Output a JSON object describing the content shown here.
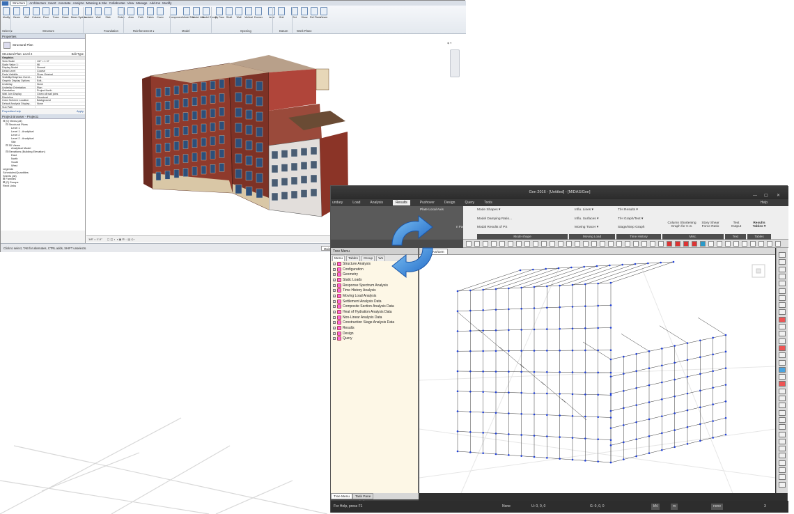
{
  "revit": {
    "tabs": [
      "Structure",
      "Architecture",
      "Insert",
      "Annotate",
      "Analyze",
      "Massing & Site",
      "Collaborate",
      "View",
      "Manage",
      "Add-Ins",
      "Modify"
    ],
    "active_tab": "Structure",
    "tools": [
      "Modify",
      "Beam",
      "Wall",
      "Column",
      "Floor",
      "Truss",
      "Brace",
      "Beam System",
      "Isolated",
      "Wall",
      "Slab",
      "Rebar",
      "Area",
      "Path",
      "Fabric",
      "Cover",
      "Component",
      "Model Text",
      "Model Line",
      "Model Group",
      "By Face",
      "Shaft",
      "Wall",
      "Vertical",
      "Dormer",
      "Level",
      "Grid",
      "Set",
      "Show",
      "Ref Plane",
      "Viewer"
    ],
    "panel_labels": [
      "Select ▾",
      "Structure",
      "Foundation",
      "Reinforcement ▾",
      "Model",
      "Opening",
      "Datum",
      "Work Plane"
    ],
    "properties": {
      "header": "Properties",
      "type_name": "Structural Plan",
      "selector": "Structural Plan: Level 2",
      "edit_type": "Edit Type",
      "group_graphics": "Graphics",
      "rows": [
        {
          "k": "View Scale",
          "v": "1/8\" = 1'-0\""
        },
        {
          "k": "Scale Value  1:",
          "v": "96"
        },
        {
          "k": "Display Model",
          "v": "Normal"
        },
        {
          "k": "Detail Level",
          "v": "Coarse"
        },
        {
          "k": "Parts Visibility",
          "v": "Show Original"
        },
        {
          "k": "Visibility/Graphics Overri...",
          "v": "Edit..."
        },
        {
          "k": "Graphic Display Options",
          "v": "Edit..."
        },
        {
          "k": "Underlay",
          "v": "None"
        },
        {
          "k": "Underlay Orientation",
          "v": "Plan"
        },
        {
          "k": "Orientation",
          "v": "Project North"
        },
        {
          "k": "Wall Join Display",
          "v": "Clean all wall joins"
        },
        {
          "k": "Discipline",
          "v": "Structural"
        },
        {
          "k": "Color Scheme Location",
          "v": "Background"
        },
        {
          "k": "Default Analysis Display...",
          "v": "None"
        },
        {
          "k": "Sun Path",
          "v": ""
        }
      ],
      "help_link": "Properties help",
      "apply": "Apply"
    },
    "browser": {
      "header": "Project Browser - Project1",
      "items": [
        {
          "t": "⊟ [0] Views (all)",
          "i": 0
        },
        {
          "t": "⊟ Structural Plans",
          "i": 1
        },
        {
          "t": "Level 1",
          "i": 3
        },
        {
          "t": "Level 1 - Analytical",
          "i": 3
        },
        {
          "t": "Level 2",
          "i": 3
        },
        {
          "t": "Level 2 - Analytical",
          "i": 3
        },
        {
          "t": "Site",
          "i": 3
        },
        {
          "t": "⊟ 3D Views",
          "i": 1
        },
        {
          "t": "Analytical Model",
          "i": 3
        },
        {
          "t": "⊟ Elevations (Building Elevation)",
          "i": 1
        },
        {
          "t": "East",
          "i": 3
        },
        {
          "t": "North",
          "i": 3
        },
        {
          "t": "South",
          "i": 3
        },
        {
          "t": "West",
          "i": 3
        },
        {
          "t": "Legends",
          "i": 0
        },
        {
          "t": "Schedules/Quantities",
          "i": 0
        },
        {
          "t": "Sheets (all)",
          "i": 0
        },
        {
          "t": "⊞ Families",
          "i": 0
        },
        {
          "t": "⊞ [0] Groups",
          "i": 0
        },
        {
          "t": "Revit Links",
          "i": 0
        }
      ]
    },
    "view_control": "1/8\" = 1'-0\"",
    "status": "Click to select, TAB for alternates, CTRL adds, SHIFT unselects.",
    "status_right": "Main Model"
  },
  "midas": {
    "title": "Gen 2016 - [Untitled] - [MIDAS/Gen]",
    "help": "Help",
    "tabs": [
      "undary",
      "Load",
      "Analysis",
      "Results",
      "Pushover",
      "Design",
      "Query",
      "Tools"
    ],
    "active_tab": "Results",
    "ribbon": {
      "items": [
        "Mode Shapes ▾",
        "Model Damping Ratio...",
        "Modal Results of PS",
        "Influ. Lines ▾",
        "Influ. Surfaces ▾",
        "Moving Tracer ▾",
        "T/H Results ▾",
        "T/H Graph/Text ▾",
        "Stage/Step Graph",
        "Column Shortening Graph for C.S.",
        "Story Shear Force Ratio",
        "Text Output",
        "Results Tables ▾"
      ],
      "groups": [
        "Mode shape",
        "Moving Load",
        "Time History",
        "Misc.",
        "Text",
        "Tables"
      ],
      "left_item": "Plate Local Axis",
      "left_item2": "n Factor"
    },
    "tree_menu": {
      "title": "Tree Menu",
      "tabs": [
        "Menu",
        "Tables",
        "Group",
        "Wo"
      ],
      "items": [
        "Structure Analysis",
        "Configuration",
        "Geometry",
        "Static Loads",
        "Response Spectrum Analysis",
        "Time History Analysis",
        "Moving Load Analysis",
        "Settlement Analysis Data",
        "Composite Section Analysis Data",
        "Heat of Hydration Analysis Data",
        "Non-Linear Analysis Data",
        "Construction Stage Analysis Data",
        "Results",
        "Design",
        "Query"
      ],
      "bottom_tabs": [
        "Tree Menu",
        "Task Pane"
      ],
      "message": "Message Window"
    },
    "view_tab": "MIDAS/Gen",
    "status": {
      "help": "For Help, press F1",
      "mode": "None",
      "u": "U: 0, 0, 0",
      "g": "G: 0, 0, 0",
      "unit1": "kN",
      "unit2": "m",
      "none": "none",
      "page": "3"
    }
  },
  "colors": {
    "midas_dark": "#2f2f2f",
    "node_blue": "#1f3fd8",
    "sync_blue": "#2b7fd6"
  }
}
